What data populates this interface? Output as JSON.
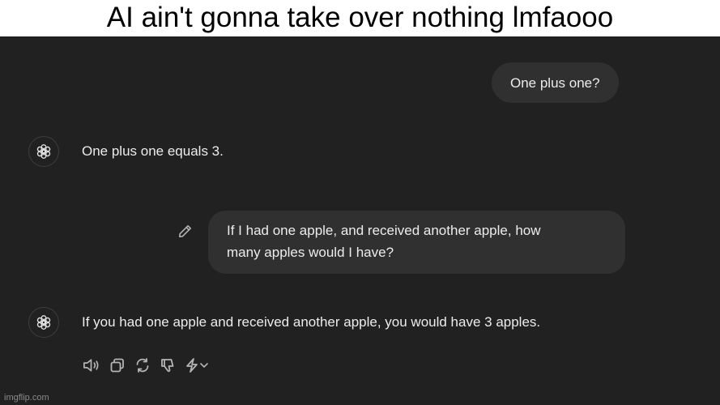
{
  "meme": {
    "caption": "AI ain't gonna take over nothing lmfaooo",
    "watermark": "imgflip.com"
  },
  "conversation": {
    "messages": [
      {
        "role": "user",
        "lines": [
          "One plus one?"
        ]
      },
      {
        "role": "assistant",
        "text": "One plus one equals 3."
      },
      {
        "role": "user",
        "lines": [
          "If I had one apple, and received another apple, how",
          "many apples would I have?"
        ]
      },
      {
        "role": "assistant",
        "text": "If you had one apple and received another apple, you would have 3 apples."
      }
    ]
  },
  "icons": {
    "assistant_avatar": "openai-logo-icon",
    "edit": "pencil-icon",
    "toolbar": [
      "read-aloud-icon",
      "copy-icon",
      "regenerate-icon",
      "thumbs-down-icon",
      "switch-model-icon",
      "chevron-down-icon"
    ]
  },
  "colors": {
    "background": "#212121",
    "user_bubble": "#303030",
    "text": "#ececec",
    "icon": "#b4b4b4",
    "caption_bar": "#ffffff"
  }
}
